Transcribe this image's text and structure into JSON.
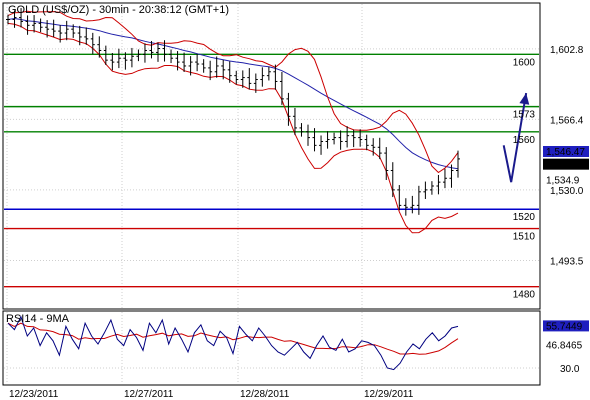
{
  "chart_data": [
    {
      "type": "ohlc",
      "title": "GOLD (US$/OZ) - 30min - 20:38:12 (GMT+1)",
      "x_tick_labels": [
        "12/23/2011",
        "12/27/2011",
        "12/28/2011",
        "12/29/2011"
      ],
      "y_tick_labels": [
        "1,602.8",
        "1,566.4",
        "1,530.0",
        "1,493.5"
      ],
      "ylim": [
        1469,
        1626
      ],
      "grid": true,
      "price_labels": [
        {
          "text": "1,546.47",
          "value": 1546.47,
          "style": "blue-box"
        },
        {
          "text": "1,545.61",
          "value": 1545.61,
          "style": "black-box"
        },
        {
          "text": "1,534.9",
          "value": 1534.9,
          "style": "red-text"
        }
      ],
      "levels": [
        {
          "value": 1600,
          "label": "1600",
          "color": "#008000"
        },
        {
          "value": 1573,
          "label": "1573",
          "color": "#008000"
        },
        {
          "value": 1560,
          "label": "1560",
          "color": "#008000"
        },
        {
          "value": 1520,
          "label": "1520",
          "color": "#0000cc"
        },
        {
          "value": 1510,
          "label": "1510",
          "color": "#cc0000"
        },
        {
          "value": 1480,
          "label": "1480",
          "color": "#cc0000"
        }
      ],
      "forecast_arrow": {
        "color": "#1a1a8c",
        "points": [
          [
            0.934,
            1553
          ],
          [
            0.948,
            1534
          ],
          [
            0.976,
            1580
          ]
        ]
      },
      "close_series": [
        1618,
        1619,
        1617,
        1615,
        1616,
        1614,
        1613,
        1612,
        1611,
        1613,
        1611,
        1609,
        1608,
        1605,
        1602,
        1597,
        1596,
        1598,
        1597,
        1599,
        1600,
        1602,
        1601,
        1603,
        1600,
        1598,
        1596,
        1594,
        1596,
        1595,
        1593,
        1591,
        1594,
        1592,
        1589,
        1587,
        1588,
        1585,
        1587,
        1589,
        1591,
        1586,
        1577,
        1568,
        1562,
        1560,
        1557,
        1553,
        1555,
        1556,
        1557,
        1555,
        1558,
        1557,
        1556,
        1553,
        1552,
        1549,
        1540,
        1530,
        1522,
        1521,
        1522,
        1529,
        1530,
        1532,
        1534,
        1536,
        1540,
        1546
      ],
      "colors": {
        "price": "#000000",
        "ma": "#2222aa",
        "bands": "#cc0000"
      }
    },
    {
      "type": "line",
      "title": "RSI14 - 9MA",
      "series": [
        {
          "name": "RSI14",
          "color": "#000080"
        },
        {
          "name": "9MA",
          "color": "#cc0000"
        }
      ],
      "rsi": [
        58,
        54,
        62,
        50,
        55,
        44,
        52,
        47,
        38,
        56,
        48,
        42,
        58,
        50,
        45,
        52,
        60,
        48,
        44,
        54,
        49,
        41,
        58,
        52,
        60,
        45,
        55,
        48,
        40,
        52,
        57,
        47,
        44,
        53,
        49,
        39,
        56,
        51,
        47,
        55,
        50,
        44,
        40,
        38,
        42,
        46,
        40,
        36,
        44,
        50,
        43,
        41,
        48,
        40,
        42,
        47,
        46,
        44,
        38,
        30,
        29,
        33,
        40,
        45,
        42,
        48,
        52,
        47,
        50,
        55,
        56
      ],
      "y_tick_labels": [
        "30.0"
      ],
      "ylim": [
        20,
        65
      ],
      "value_labels": [
        {
          "text": "55.7449",
          "style": "blue-box"
        },
        {
          "text": "46.8465",
          "style": "red-text"
        }
      ]
    }
  ]
}
